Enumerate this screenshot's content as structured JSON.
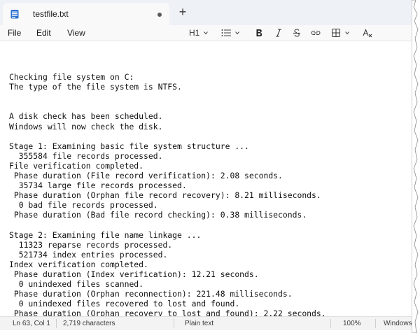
{
  "tab": {
    "title": "testfile.txt",
    "new_tab_symbol": "+"
  },
  "menu": {
    "file": "File",
    "edit": "Edit",
    "view": "View"
  },
  "toolbar": {
    "heading": "H1"
  },
  "document": {
    "lines": [
      "Checking file system on C:",
      "The type of the file system is NTFS.",
      "",
      "",
      "A disk check has been scheduled.",
      "Windows will now check the disk.",
      "",
      "Stage 1: Examining basic file system structure ...",
      "  355584 file records processed.",
      "File verification completed.",
      " Phase duration (File record verification): 2.08 seconds.",
      "  35734 large file records processed.",
      " Phase duration (Orphan file record recovery): 8.21 milliseconds.",
      "  0 bad file records processed.",
      " Phase duration (Bad file record checking): 0.38 milliseconds.",
      "",
      "Stage 2: Examining file name linkage ...",
      "  11323 reparse records processed.",
      "  521734 index entries processed.",
      "Index verification completed.",
      " Phase duration (Index verification): 12.21 seconds.",
      "  0 unindexed files scanned.",
      " Phase duration (Orphan reconnection): 221.48 milliseconds.",
      "  0 unindexed files recovered to lost and found.",
      " Phase duration (Orphan recovery to lost and found): 2.22 seconds."
    ]
  },
  "status": {
    "position": "Ln 63, Col 1",
    "chars": "2,719 characters",
    "format": "Plain text",
    "zoom": "100%",
    "line_ending": "Windows"
  }
}
